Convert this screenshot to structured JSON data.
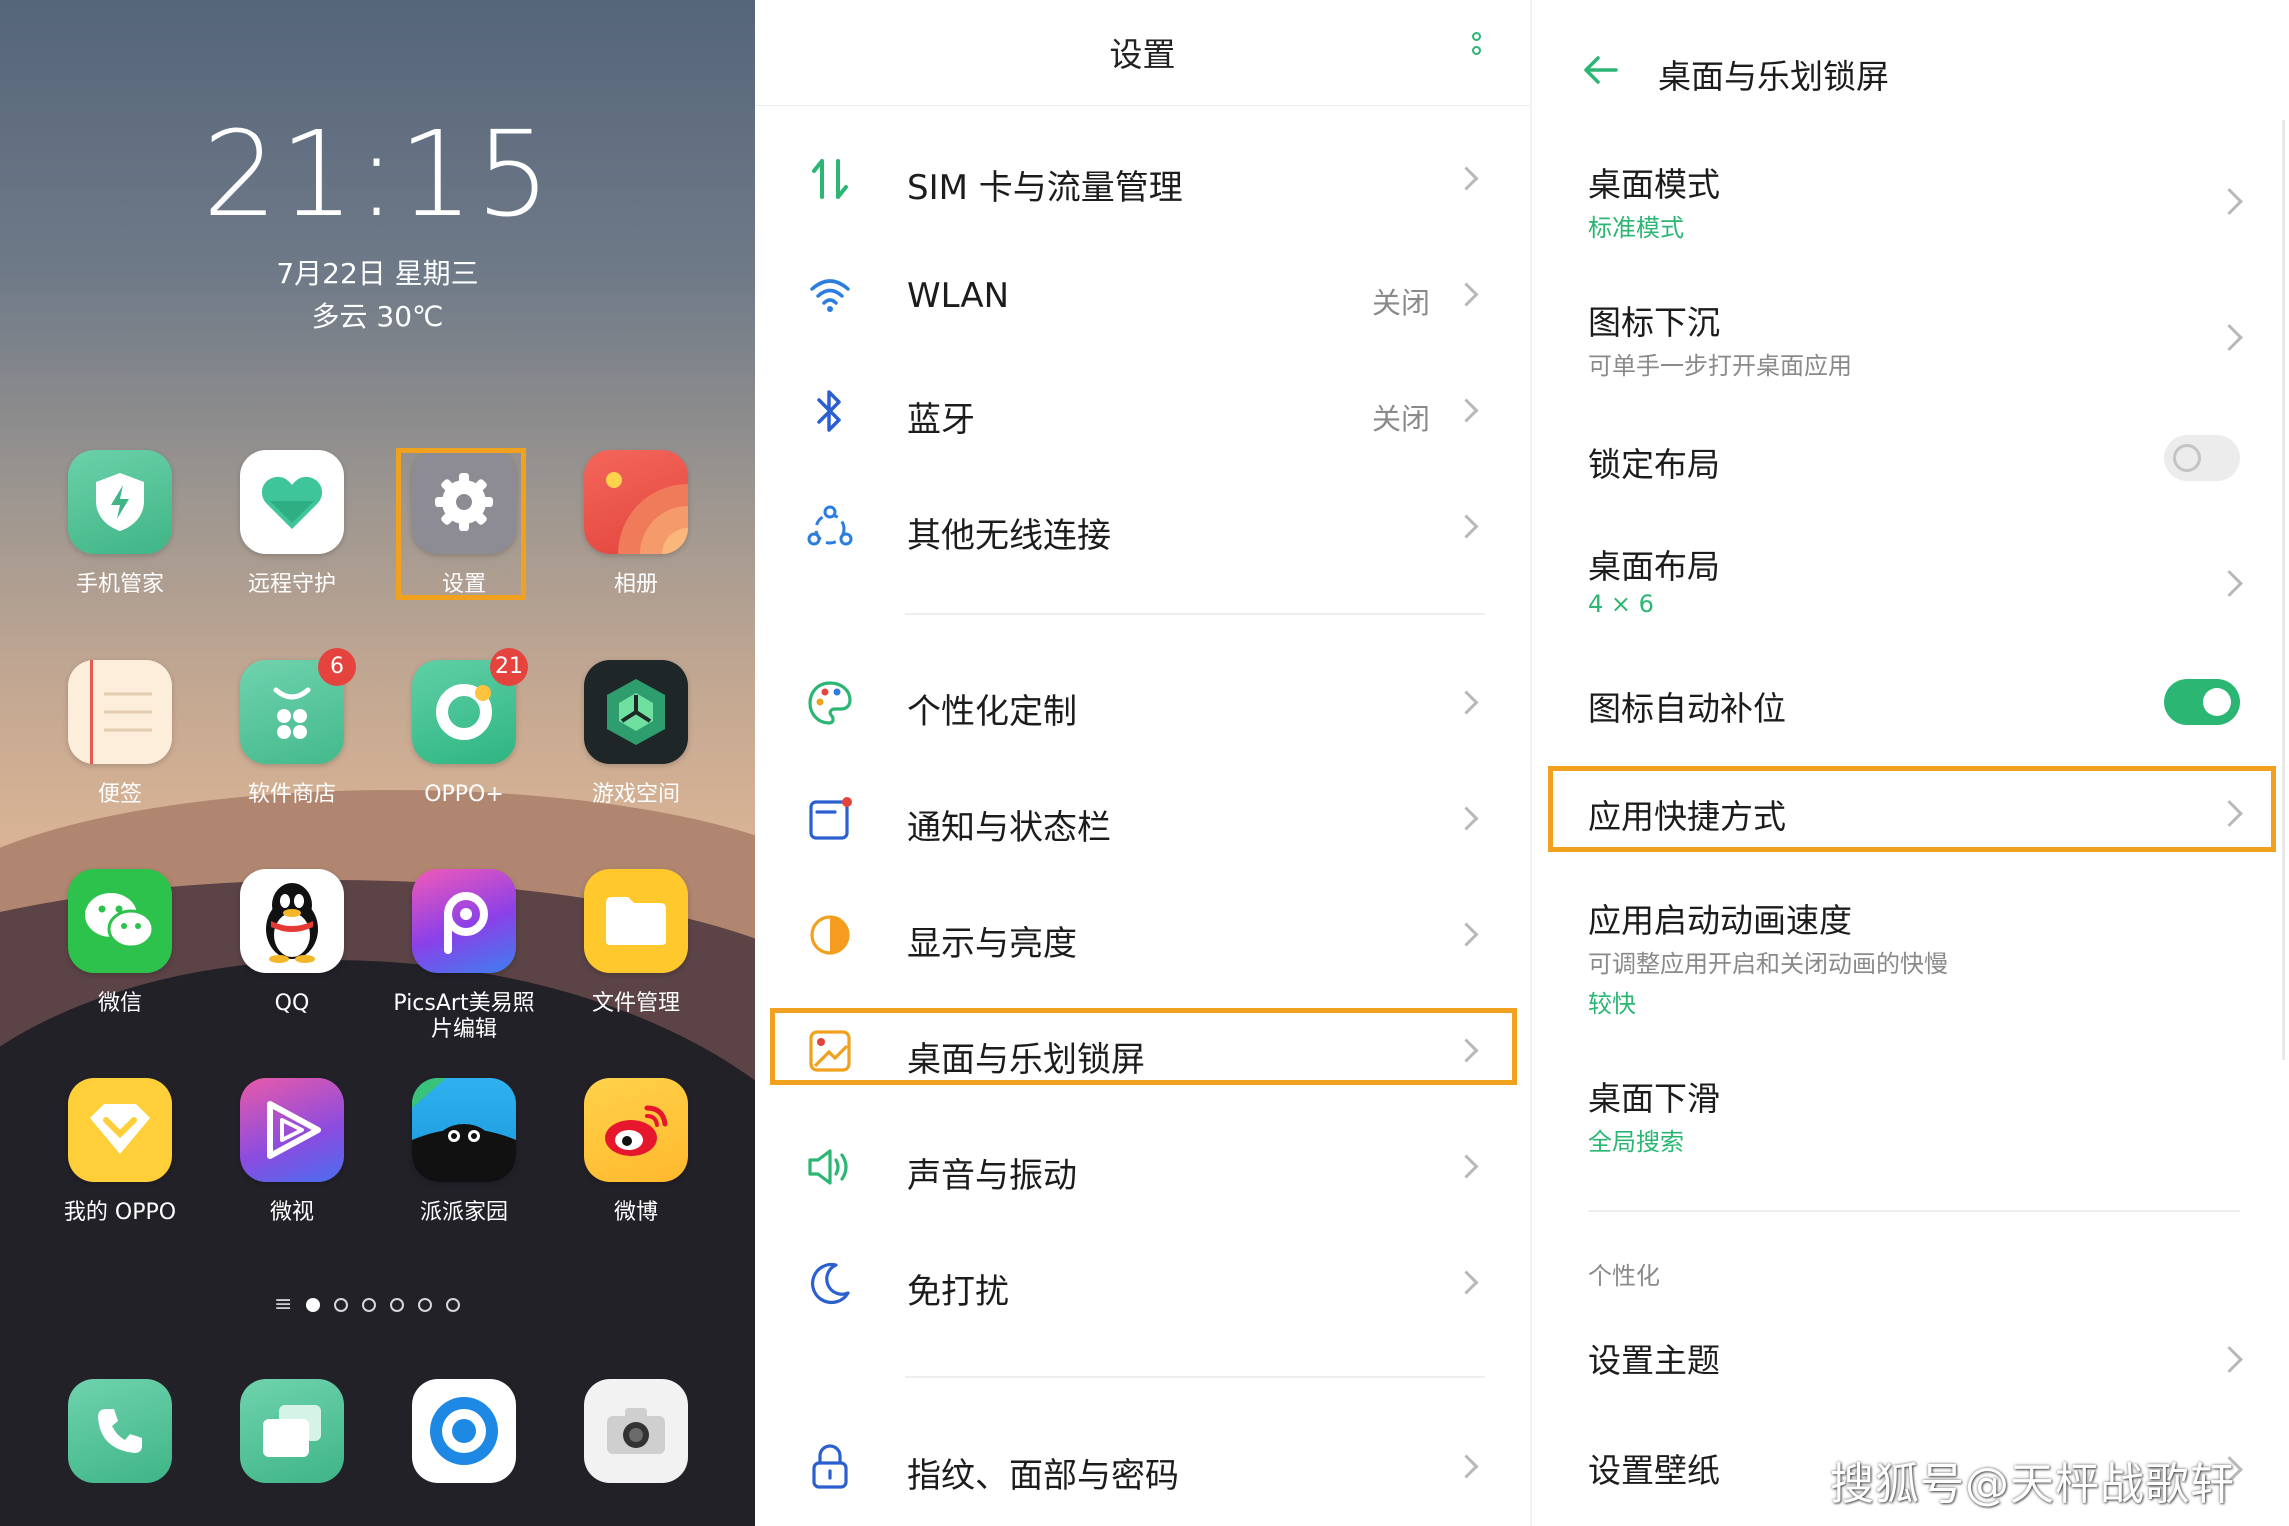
{
  "home": {
    "time": "21:15",
    "date": "7月22日 星期三",
    "weather": "多云 30℃",
    "apps": [
      {
        "label": "手机管家",
        "icon": "phone-manager-icon"
      },
      {
        "label": "远程守护",
        "icon": "remote-guard-icon"
      },
      {
        "label": "设置",
        "icon": "settings-gear-icon"
      },
      {
        "label": "相册",
        "icon": "gallery-icon"
      },
      {
        "label": "便签",
        "icon": "notes-icon"
      },
      {
        "label": "软件商店",
        "icon": "app-store-icon",
        "badge": "6"
      },
      {
        "label": "OPPO+",
        "icon": "oppo-plus-icon",
        "badge": "21"
      },
      {
        "label": "游戏空间",
        "icon": "game-space-icon"
      },
      {
        "label": "微信",
        "icon": "wechat-icon"
      },
      {
        "label": "QQ",
        "icon": "qq-icon"
      },
      {
        "label": "PicsArt美易照",
        "label2": "片编辑",
        "icon": "picsart-icon"
      },
      {
        "label": "文件管理",
        "icon": "file-manager-icon"
      },
      {
        "label": "我的 OPPO",
        "icon": "my-oppo-icon"
      },
      {
        "label": "微视",
        "icon": "weishi-icon"
      },
      {
        "label": "派派家园",
        "icon": "paipai-icon"
      },
      {
        "label": "微博",
        "icon": "weibo-icon"
      }
    ],
    "page_indicator": {
      "pages": 6,
      "current": 1
    },
    "dock": [
      "phone-icon",
      "multitask-icon",
      "browser-icon",
      "camera-icon"
    ],
    "highlight_color": "#f0a11e"
  },
  "settings": {
    "title": "设置",
    "rows": [
      {
        "label": "SIM 卡与流量管理",
        "value": "",
        "icon": "sim-data-icon"
      },
      {
        "label": "WLAN",
        "value": "关闭",
        "icon": "wifi-icon"
      },
      {
        "label": "蓝牙",
        "value": "关闭",
        "icon": "bluetooth-icon"
      },
      {
        "label": "其他无线连接",
        "value": "",
        "icon": "wireless-connections-icon"
      },
      {
        "label": "个性化定制",
        "value": "",
        "icon": "palette-icon"
      },
      {
        "label": "通知与状态栏",
        "value": "",
        "icon": "notification-icon"
      },
      {
        "label": "显示与亮度",
        "value": "",
        "icon": "brightness-icon"
      },
      {
        "label": "桌面与乐划锁屏",
        "value": "",
        "icon": "desktop-lockscreen-icon"
      },
      {
        "label": "声音与振动",
        "value": "",
        "icon": "speaker-icon"
      },
      {
        "label": "免打扰",
        "value": "",
        "icon": "moon-icon"
      },
      {
        "label": "指纹、面部与密码",
        "value": "",
        "icon": "lock-icon"
      }
    ]
  },
  "desktop": {
    "title": "桌面与乐划锁屏",
    "items": [
      {
        "title": "桌面模式",
        "sub": "标准模式"
      },
      {
        "title": "图标下沉",
        "sub": "可单手一步打开桌面应用"
      },
      {
        "title": "锁定布局",
        "toggle": false
      },
      {
        "title": "桌面布局",
        "sub": "4 × 6"
      },
      {
        "title": "图标自动补位",
        "toggle": true
      },
      {
        "title": "应用快捷方式"
      },
      {
        "title": "应用启动动画速度",
        "sub": "可调整应用开启和关闭动画的快慢",
        "sub2": "较快"
      },
      {
        "title": "桌面下滑",
        "sub": "全局搜索"
      }
    ],
    "section": "个性化",
    "section_items": [
      {
        "title": "设置主题"
      },
      {
        "title": "设置壁纸"
      }
    ],
    "accent_color": "#2bb673"
  },
  "watermark": "搜狐号@天枰战歌轩"
}
